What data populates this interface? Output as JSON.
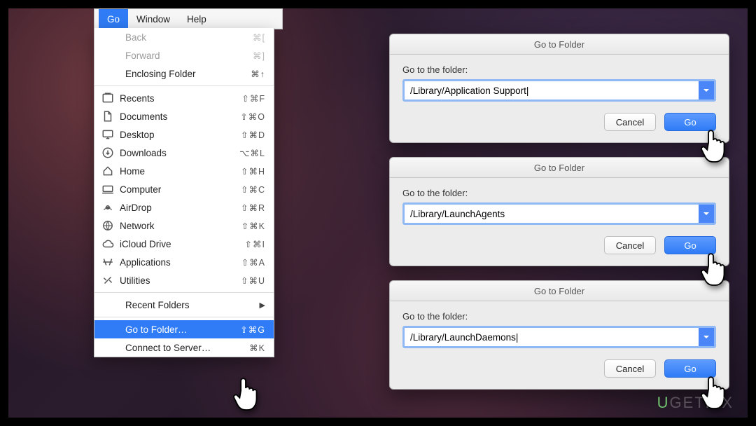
{
  "menubar": {
    "items": [
      "Go",
      "Window",
      "Help"
    ],
    "active_index": 0
  },
  "menu": {
    "nav": [
      {
        "label": "Back",
        "keys": "⌘[",
        "disabled": true
      },
      {
        "label": "Forward",
        "keys": "⌘]",
        "disabled": true
      },
      {
        "label": "Enclosing Folder",
        "keys": "⌘↑",
        "disabled": false
      }
    ],
    "places": [
      {
        "label": "Recents",
        "keys": "⇧⌘F",
        "icon": "recents"
      },
      {
        "label": "Documents",
        "keys": "⇧⌘O",
        "icon": "documents"
      },
      {
        "label": "Desktop",
        "keys": "⇧⌘D",
        "icon": "desktop"
      },
      {
        "label": "Downloads",
        "keys": "⌥⌘L",
        "icon": "downloads"
      },
      {
        "label": "Home",
        "keys": "⇧⌘H",
        "icon": "home"
      },
      {
        "label": "Computer",
        "keys": "⇧⌘C",
        "icon": "computer"
      },
      {
        "label": "AirDrop",
        "keys": "⇧⌘R",
        "icon": "airdrop"
      },
      {
        "label": "Network",
        "keys": "⇧⌘K",
        "icon": "network"
      },
      {
        "label": "iCloud Drive",
        "keys": "⇧⌘I",
        "icon": "icloud"
      },
      {
        "label": "Applications",
        "keys": "⇧⌘A",
        "icon": "apps"
      },
      {
        "label": "Utilities",
        "keys": "⇧⌘U",
        "icon": "utilities"
      }
    ],
    "recent_label": "Recent Folders",
    "goto": {
      "label": "Go to Folder…",
      "keys": "⇧⌘G"
    },
    "connect": {
      "label": "Connect to Server…",
      "keys": "⌘K"
    }
  },
  "dialogs": [
    {
      "title": "Go to Folder",
      "prompt": "Go to the folder:",
      "value": "/Library/Application Support|",
      "cancel": "Cancel",
      "go": "Go"
    },
    {
      "title": "Go to Folder",
      "prompt": "Go to the folder:",
      "value": "/Library/LaunchAgents",
      "cancel": "Cancel",
      "go": "Go"
    },
    {
      "title": "Go to Folder",
      "prompt": "Go to the folder:",
      "value": "/Library/LaunchDaemons|",
      "cancel": "Cancel",
      "go": "Go"
    }
  ],
  "watermark": {
    "u": "U",
    "rest": "GETFIX"
  }
}
